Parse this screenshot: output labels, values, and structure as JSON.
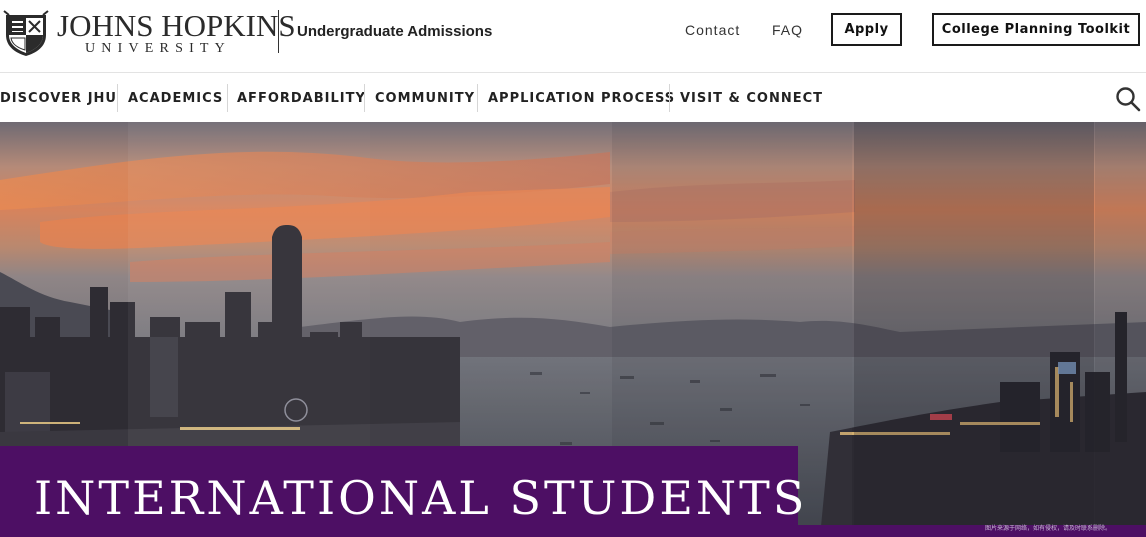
{
  "header": {
    "logo_line1": "JOHNS HOPKINS",
    "logo_line2": "UNIVERSITY",
    "site_name": "Undergraduate Admissions",
    "links": {
      "contact": "Contact",
      "faq": "FAQ"
    },
    "buttons": {
      "apply": "Apply",
      "toolkit": "College Planning Toolkit"
    }
  },
  "nav": {
    "items": [
      {
        "label": "DISCOVER JHU"
      },
      {
        "label": "ACADEMICS"
      },
      {
        "label": "AFFORDABILITY"
      },
      {
        "label": "COMMUNITY"
      },
      {
        "label": "APPLICATION PROCESS"
      },
      {
        "label": "VISIT & CONNECT"
      }
    ],
    "search_icon": "search-icon"
  },
  "hero": {
    "title": "INTERNATIONAL STUDENTS",
    "credit": "图片来源于网络，如有侵权，请及时联系删除。"
  },
  "colors": {
    "brand_purple": "#4d0f64",
    "sunset": "#e07a4a",
    "water": "#3a4452"
  }
}
